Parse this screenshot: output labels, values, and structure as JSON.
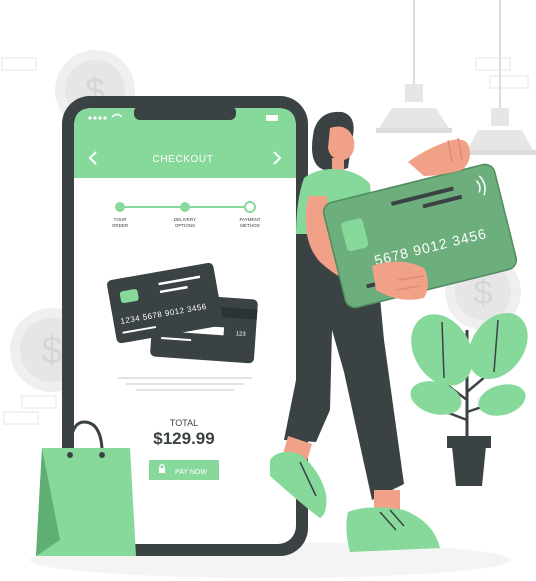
{
  "colors": {
    "accent": "#86d99a",
    "accent_dark": "#5fae73",
    "card_green": "#6cae7c",
    "dark": "#3a4244",
    "coin": "#ebebeb",
    "skin": "#f2a189",
    "background": "#ffffff"
  },
  "phone": {
    "screen_title": "CHECKOUT",
    "steps": [
      {
        "label_line1": "YOUR",
        "label_line2": "ORDER"
      },
      {
        "label_line1": "DELIVERY",
        "label_line2": "OPTIONS"
      },
      {
        "label_line1": "PAYMENT",
        "label_line2": "METHOD"
      }
    ],
    "card_front_number": "1234 5678 9012 3456",
    "card_back_cvv": "123",
    "total_label": "TOTAL",
    "total_amount": "$129.99",
    "pay_button_label": "PAY NOW",
    "icons": [
      "back-chevron-icon",
      "forward-chevron-icon",
      "lock-icon",
      "signal-dots-icon",
      "wifi-icon",
      "battery-icon"
    ]
  },
  "person": {
    "held_card_number": "5678 9012 3456",
    "icons": [
      "contactless-icon"
    ]
  },
  "scene": {
    "icons": [
      "dollar-coin-icon",
      "pendant-lamp-icon",
      "potted-plant-icon",
      "shopping-bag-icon"
    ]
  }
}
